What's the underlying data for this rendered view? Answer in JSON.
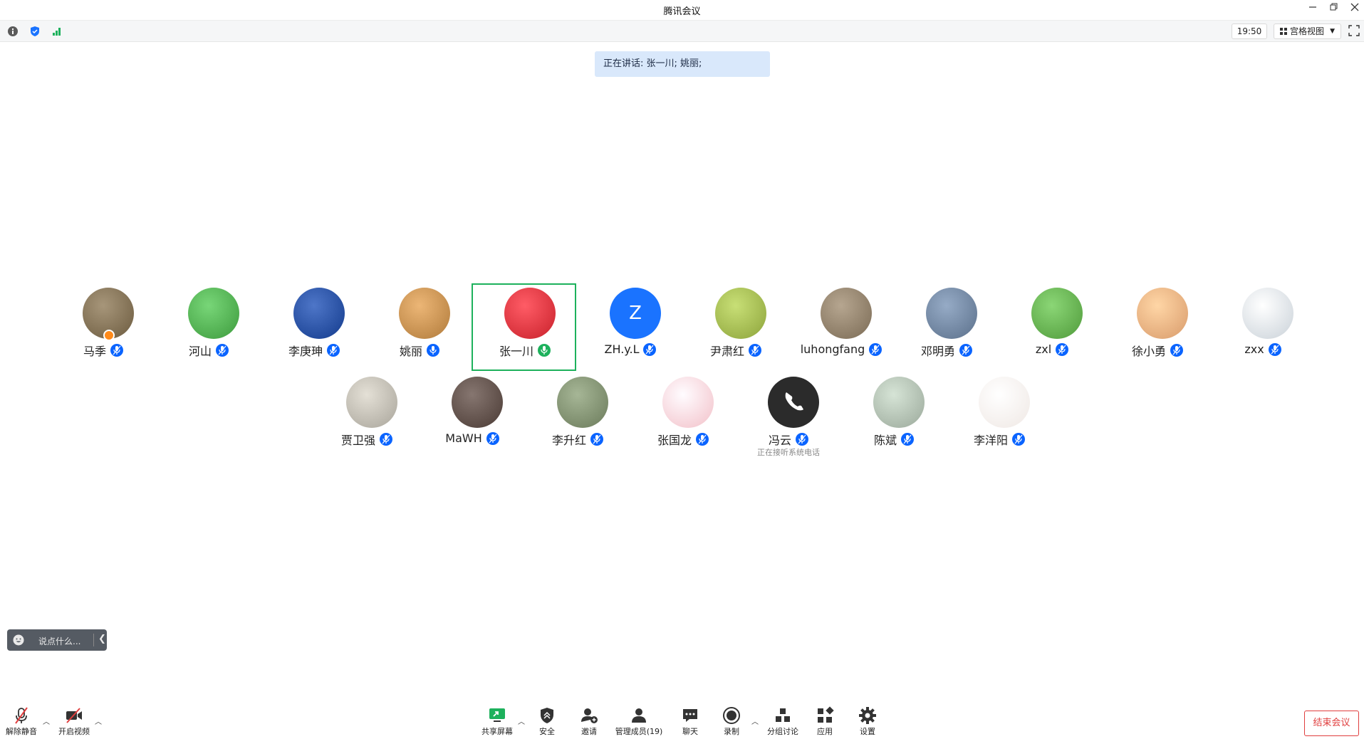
{
  "window": {
    "title": "腾讯会议"
  },
  "toolbar": {
    "time": "19:50",
    "view_label": "宫格视图"
  },
  "banner": {
    "speaking_text": "正在讲话: 张一川; 姚丽;"
  },
  "participants": [
    {
      "name": "马季",
      "avatar_color": "#6b5a3e",
      "mic": "muted"
    },
    {
      "name": "河山",
      "avatar_color": "#3c9a3c",
      "mic": "muted"
    },
    {
      "name": "李庚珅",
      "avatar_color": "#123a8c",
      "mic": "muted"
    },
    {
      "name": "姚丽",
      "avatar_color": "#b07a3a",
      "mic": "on"
    },
    {
      "name": "张一川",
      "avatar_color": "#c8202a",
      "mic": "speaking"
    },
    {
      "name": "ZH.y.L",
      "avatar_color": "#1a73ff",
      "avatar_letter": "Z",
      "mic": "muted"
    },
    {
      "name": "尹肃红",
      "avatar_color": "#8ca33a",
      "mic": "muted"
    },
    {
      "name": "luhongfang",
      "avatar_color": "#7a6a54",
      "mic": "muted"
    },
    {
      "name": "邓明勇",
      "avatar_color": "#5a6f8a",
      "mic": "muted"
    },
    {
      "name": "zxl",
      "avatar_color": "#4f9a3a",
      "mic": "muted"
    },
    {
      "name": "徐小勇",
      "avatar_color": "#d89a6a",
      "mic": "muted"
    },
    {
      "name": "zxx",
      "avatar_color": "#c9d1d8",
      "mic": "muted"
    },
    {
      "name": "贾卫强",
      "avatar_color": "#a8a49a",
      "mic": "muted"
    },
    {
      "name": "MaWH",
      "avatar_color": "#4a3a34",
      "mic": "muted"
    },
    {
      "name": "李升红",
      "avatar_color": "#6a7a5a",
      "mic": "muted"
    },
    {
      "name": "张国龙",
      "avatar_color": "#f2c0c8",
      "mic": "muted"
    },
    {
      "name": "冯云",
      "avatar_color": "#2b2b2b",
      "mic": "muted",
      "note": "正在接听系统电话"
    },
    {
      "name": "陈斌",
      "avatar_color": "#9aa89a",
      "mic": "muted"
    },
    {
      "name": "李洋阳",
      "avatar_color": "#efe8e4",
      "mic": "muted"
    }
  ],
  "chat": {
    "placeholder": "说点什么..."
  },
  "bottom_bar": {
    "unmute": "解除静音",
    "video": "开启视频",
    "share": "共享屏幕",
    "security": "安全",
    "invite": "邀请",
    "members": "管理成员(19)",
    "chat": "聊天",
    "record": "录制",
    "breakout": "分组讨论",
    "apps": "应用",
    "settings": "设置",
    "end": "结束会议"
  },
  "colors": {
    "accent": "#0a64ff",
    "speaking": "#1db15c",
    "danger": "#e03e3e"
  }
}
